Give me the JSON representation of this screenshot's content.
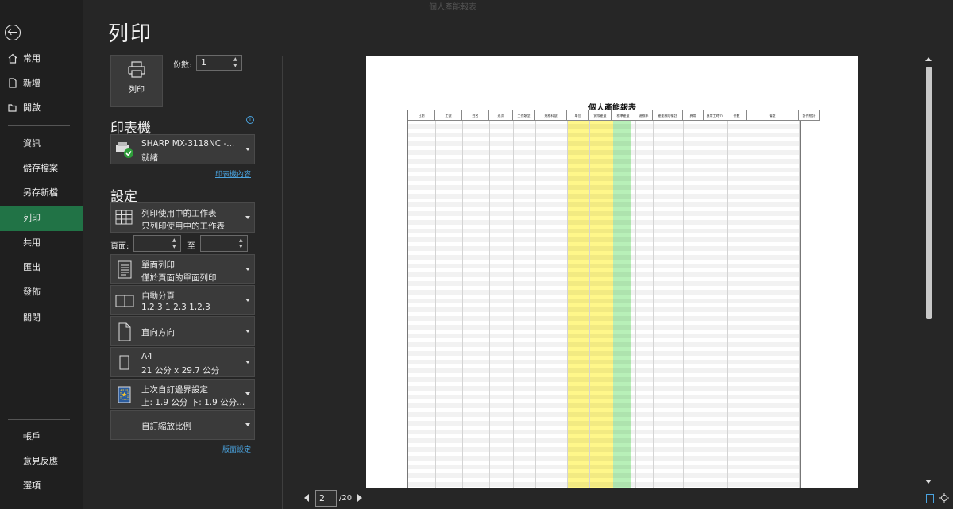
{
  "window": {
    "title": "個人產能報表"
  },
  "nav": {
    "top_items": [
      {
        "label": "常用",
        "icon": "home-icon"
      },
      {
        "label": "新增",
        "icon": "new-file-icon"
      },
      {
        "label": "開啟",
        "icon": "folder-open-icon"
      }
    ],
    "mid_items": [
      "資訊",
      "儲存檔案",
      "另存新檔",
      "列印",
      "共用",
      "匯出",
      "發佈",
      "關閉"
    ],
    "bottom_items": [
      "帳戶",
      "意見反應",
      "選項"
    ],
    "active": "列印"
  },
  "page_title": "列印",
  "print_button": {
    "label": "列印"
  },
  "copies": {
    "label": "份數:",
    "value": "1"
  },
  "printer": {
    "heading": "印表機",
    "name": "SHARP MX-3118NC -...",
    "status": "就緒",
    "properties_link": "印表機內容"
  },
  "settings": {
    "heading": "設定",
    "what": {
      "line1": "列印使用中的工作表",
      "line2": "只列印使用中的工作表"
    },
    "pages_label": "頁面:",
    "to_label": "至",
    "sides": {
      "line1": "單面列印",
      "line2": "僅於頁面的單面列印"
    },
    "collate": {
      "line1": "自動分頁",
      "line2": "1,2,3    1,2,3    1,2,3"
    },
    "orientation": {
      "line1": "直向方向"
    },
    "paper": {
      "line1": "A4",
      "line2": "21 公分 x 29.7 公分"
    },
    "margins": {
      "line1": "上次自訂邊界設定",
      "line2": "上: 1.9 公分 下: 1.9 公分..."
    },
    "scaling": {
      "line1": "自訂縮放比例"
    },
    "page_setup_link": "版面設定"
  },
  "preview": {
    "sheet_title": "個人產能報表",
    "columns": [
      "日期",
      "工號",
      "姓名",
      "班次",
      "工作類型",
      "規格料號",
      "單位",
      "實際產量",
      "標準產量",
      "達標率",
      "產能標的備註",
      "異常",
      "異常工時(h)",
      "件數",
      "備註",
      "計件統計"
    ],
    "highlight_colors": {
      "yellow": "#fff78a",
      "green": "#b8f0b8"
    }
  },
  "pager": {
    "current": "2",
    "total": "/20"
  }
}
